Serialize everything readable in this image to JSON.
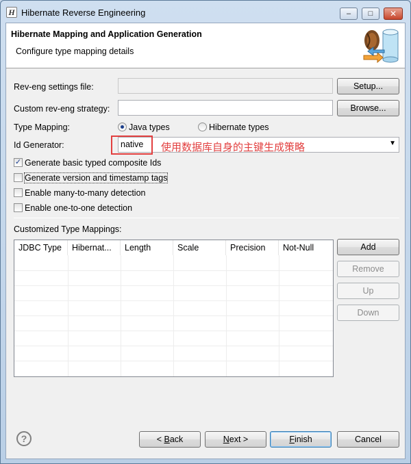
{
  "window": {
    "title": "Hibernate Reverse Engineering",
    "controls": {
      "minimize": "–",
      "maximize": "□",
      "close": "✕"
    }
  },
  "header": {
    "title": "Hibernate Mapping and Application Generation",
    "subtitle": "Configure type mapping details",
    "graphic_icon": "database-mapping-icon"
  },
  "form": {
    "reveng_settings": {
      "label": "Rev-eng settings file:",
      "value": "",
      "button": "Setup..."
    },
    "custom_strategy": {
      "label": "Custom rev-eng strategy:",
      "value": "",
      "button": "Browse..."
    },
    "type_mapping": {
      "label": "Type Mapping:",
      "options": [
        {
          "label": "Java types",
          "selected": true
        },
        {
          "label": "Hibernate types",
          "selected": false
        }
      ]
    },
    "id_generator": {
      "label": "Id Generator:",
      "value": "native",
      "annotation": "使用数据库自身的主键生成策略"
    },
    "checkboxes": [
      {
        "label": "Generate basic typed composite Ids",
        "checked": true
      },
      {
        "label": "Generate version and timestamp tags",
        "checked": false
      },
      {
        "label": "Enable many-to-many detection",
        "checked": false
      },
      {
        "label": "Enable one-to-one detection",
        "checked": false
      }
    ]
  },
  "mappings": {
    "label": "Customized Type Mappings:",
    "columns": [
      "JDBC Type",
      "Hibernat...",
      "Length",
      "Scale",
      "Precision",
      "Not-Null"
    ],
    "rows": [],
    "buttons": {
      "add": "Add",
      "remove": "Remove",
      "up": "Up",
      "down": "Down"
    }
  },
  "footer": {
    "help": "?",
    "back_prefix": "< ",
    "back_mnemonic": "B",
    "back_rest": "ack",
    "next_mnemonic": "N",
    "next_rest": "ext >",
    "finish_mnemonic": "F",
    "finish_rest": "inish",
    "cancel": "Cancel"
  },
  "colors": {
    "annotation": "#e23f3f",
    "accent": "#3c7fb1"
  }
}
